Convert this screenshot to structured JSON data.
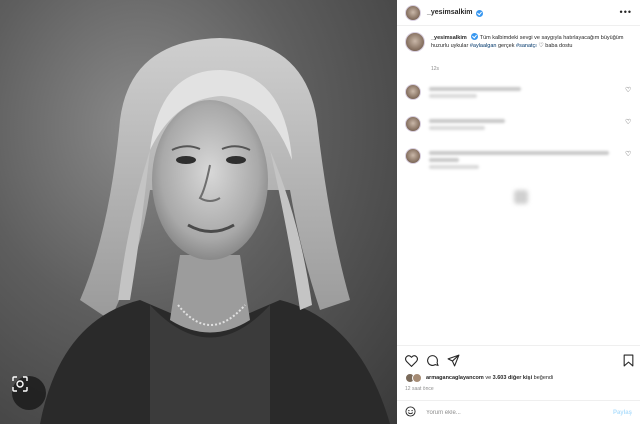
{
  "post": {
    "username": "_yesimsalkim",
    "more_label": "•••",
    "caption": {
      "text_pre": "Tüm kalbimdeki sevgi ve saygıyla hatırlayacağım büyüğüm huzurlu uykular",
      "hashtag_1": "#aylaalgan",
      "mid": "gerçek",
      "hashtag_2": "#sanatçı",
      "heart": "♡",
      "text_post": "baba dostu"
    },
    "caption_time": "12s",
    "comments": [
      {
        "username": "",
        "text": "",
        "time": ""
      },
      {
        "username": "",
        "text": "",
        "time": ""
      },
      {
        "username": "",
        "text": "",
        "time": ""
      }
    ],
    "likes": {
      "liked_by": "armagancaglayancom",
      "connector": "ve",
      "others": "3.603 diğer kişi",
      "suffix": "beğendi"
    },
    "post_time": "12 saat önce",
    "comment_placeholder": "Yorum ekle...",
    "post_button": "Paylaş"
  },
  "icons": {
    "lens": "lens-icon",
    "verified": "verified-badge-icon",
    "like": "heart-icon",
    "comment": "comment-icon",
    "share": "share-icon",
    "save": "bookmark-icon",
    "emoji": "emoji-icon"
  },
  "colors": {
    "verified_blue": "#3897f0",
    "hashtag": "#00376b",
    "muted_text": "#8e8e8e",
    "post_button_disabled": "#b2dffc"
  }
}
